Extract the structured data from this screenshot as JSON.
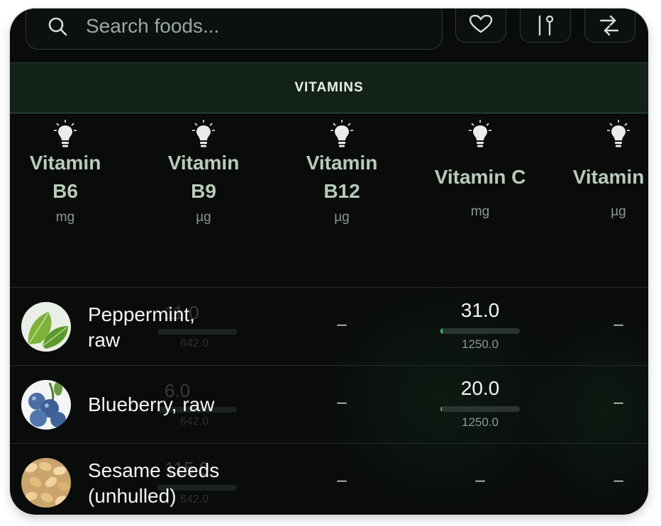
{
  "search": {
    "placeholder": "Search foods..."
  },
  "toolbar": {
    "icons": [
      "heart-icon",
      "fork-knife-icon",
      "swap-icon"
    ]
  },
  "section": {
    "title": "VITAMINS"
  },
  "columns": [
    {
      "name": "Vitamin\nB6",
      "unit": "mg",
      "lines": 2
    },
    {
      "name": "Vitamin\nB9",
      "unit": "µg",
      "lines": 2
    },
    {
      "name": "Vitamin\nB12",
      "unit": "µg",
      "lines": 2
    },
    {
      "name": "Vitamin C",
      "unit": "mg",
      "lines": 1
    },
    {
      "name": "Vitamin D",
      "unit": "µg",
      "lines": 1
    }
  ],
  "rows": [
    {
      "name": "Peppermint,\nraw",
      "ghost": {
        "value": "11.0",
        "ref": "642.0"
      },
      "cells": [
        "–",
        "31.0",
        "–"
      ],
      "vitc": {
        "value": "31.0",
        "ref": "1250.0",
        "fraction": 0.025
      }
    },
    {
      "name": "Blueberry, raw",
      "ghost": {
        "value": "6.0",
        "ref": "642.0"
      },
      "cells": [
        "–",
        "20.0",
        "–"
      ],
      "vitc": {
        "value": "20.0",
        "ref": "1250.0",
        "fraction": 0.016
      }
    },
    {
      "name": "Sesame seeds\n(unhulled)",
      "ghost": {
        "value": "115.0",
        "ref": "642.0"
      },
      "cells": [
        "–",
        "–",
        "–"
      ]
    }
  ],
  "colors": {
    "accent": "#3ec46d",
    "header_bg": "#132219",
    "text": "#b8cbb9"
  }
}
